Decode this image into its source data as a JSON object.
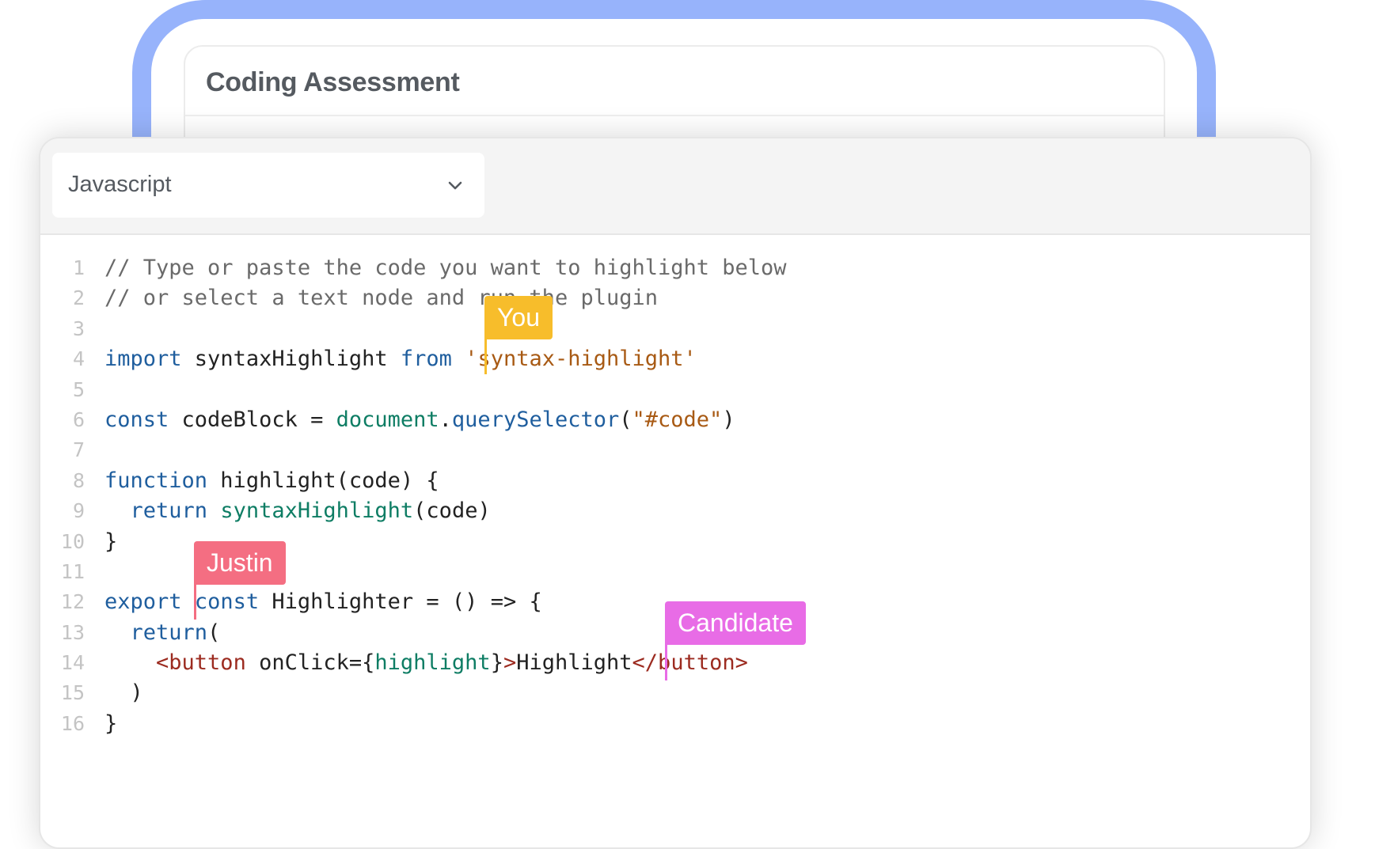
{
  "back_card": {
    "title": "Coding Assessment"
  },
  "language_select": {
    "value": "Javascript",
    "icon": "chevron-down-icon"
  },
  "lines": [
    {
      "n": "1",
      "tokens": [
        {
          "c": "cm",
          "t": "// Type or paste the code you want to highlight below"
        }
      ]
    },
    {
      "n": "2",
      "tokens": [
        {
          "c": "cm",
          "t": "// or select a text node and run the plugin"
        }
      ]
    },
    {
      "n": "3",
      "tokens": []
    },
    {
      "n": "4",
      "tokens": [
        {
          "c": "kw",
          "t": "import"
        },
        {
          "c": "pl",
          "t": " syntaxHighlight "
        },
        {
          "c": "kw",
          "t": "from"
        },
        {
          "c": "pl",
          "t": " "
        },
        {
          "c": "str",
          "t": "'syntax-highlight'"
        }
      ]
    },
    {
      "n": "5",
      "tokens": []
    },
    {
      "n": "6",
      "tokens": [
        {
          "c": "kw",
          "t": "const"
        },
        {
          "c": "pl",
          "t": " codeBlock = "
        },
        {
          "c": "fn",
          "t": "document"
        },
        {
          "c": "pl",
          "t": "."
        },
        {
          "c": "kw",
          "t": "querySelector"
        },
        {
          "c": "pl",
          "t": "("
        },
        {
          "c": "str",
          "t": "\"#code\""
        },
        {
          "c": "pl",
          "t": ")"
        }
      ]
    },
    {
      "n": "7",
      "tokens": []
    },
    {
      "n": "8",
      "tokens": [
        {
          "c": "kw",
          "t": "function"
        },
        {
          "c": "pl",
          "t": " highlight(code) {"
        }
      ]
    },
    {
      "n": "9",
      "tokens": [
        {
          "c": "pl",
          "t": "  "
        },
        {
          "c": "kw",
          "t": "return"
        },
        {
          "c": "pl",
          "t": " "
        },
        {
          "c": "fn",
          "t": "syntaxHighlight"
        },
        {
          "c": "pl",
          "t": "(code)"
        }
      ]
    },
    {
      "n": "10",
      "tokens": [
        {
          "c": "pl",
          "t": "}"
        }
      ]
    },
    {
      "n": "11",
      "tokens": []
    },
    {
      "n": "12",
      "tokens": [
        {
          "c": "kw",
          "t": "export"
        },
        {
          "c": "pl",
          "t": " "
        },
        {
          "c": "kw",
          "t": "const"
        },
        {
          "c": "pl",
          "t": " Highlighter = () => {"
        }
      ]
    },
    {
      "n": "13",
      "tokens": [
        {
          "c": "pl",
          "t": "  "
        },
        {
          "c": "kw",
          "t": "return"
        },
        {
          "c": "pl",
          "t": "("
        }
      ]
    },
    {
      "n": "14",
      "tokens": [
        {
          "c": "pl",
          "t": "    "
        },
        {
          "c": "tag",
          "t": "<button"
        },
        {
          "c": "pl",
          "t": " onClick={"
        },
        {
          "c": "fn",
          "t": "highlight"
        },
        {
          "c": "pl",
          "t": "}"
        },
        {
          "c": "tag",
          "t": ">"
        },
        {
          "c": "pl",
          "t": "Highlight"
        },
        {
          "c": "tag",
          "t": "</button>"
        }
      ]
    },
    {
      "n": "15",
      "tokens": [
        {
          "c": "pl",
          "t": "  )"
        }
      ]
    },
    {
      "n": "16",
      "tokens": [
        {
          "c": "pl",
          "t": "}"
        }
      ]
    }
  ],
  "cursors": [
    {
      "label": "You",
      "color": "#f7bd2b"
    },
    {
      "label": "Justin",
      "color": "#f46e82"
    },
    {
      "label": "Candidate",
      "color": "#e86ce6"
    }
  ]
}
